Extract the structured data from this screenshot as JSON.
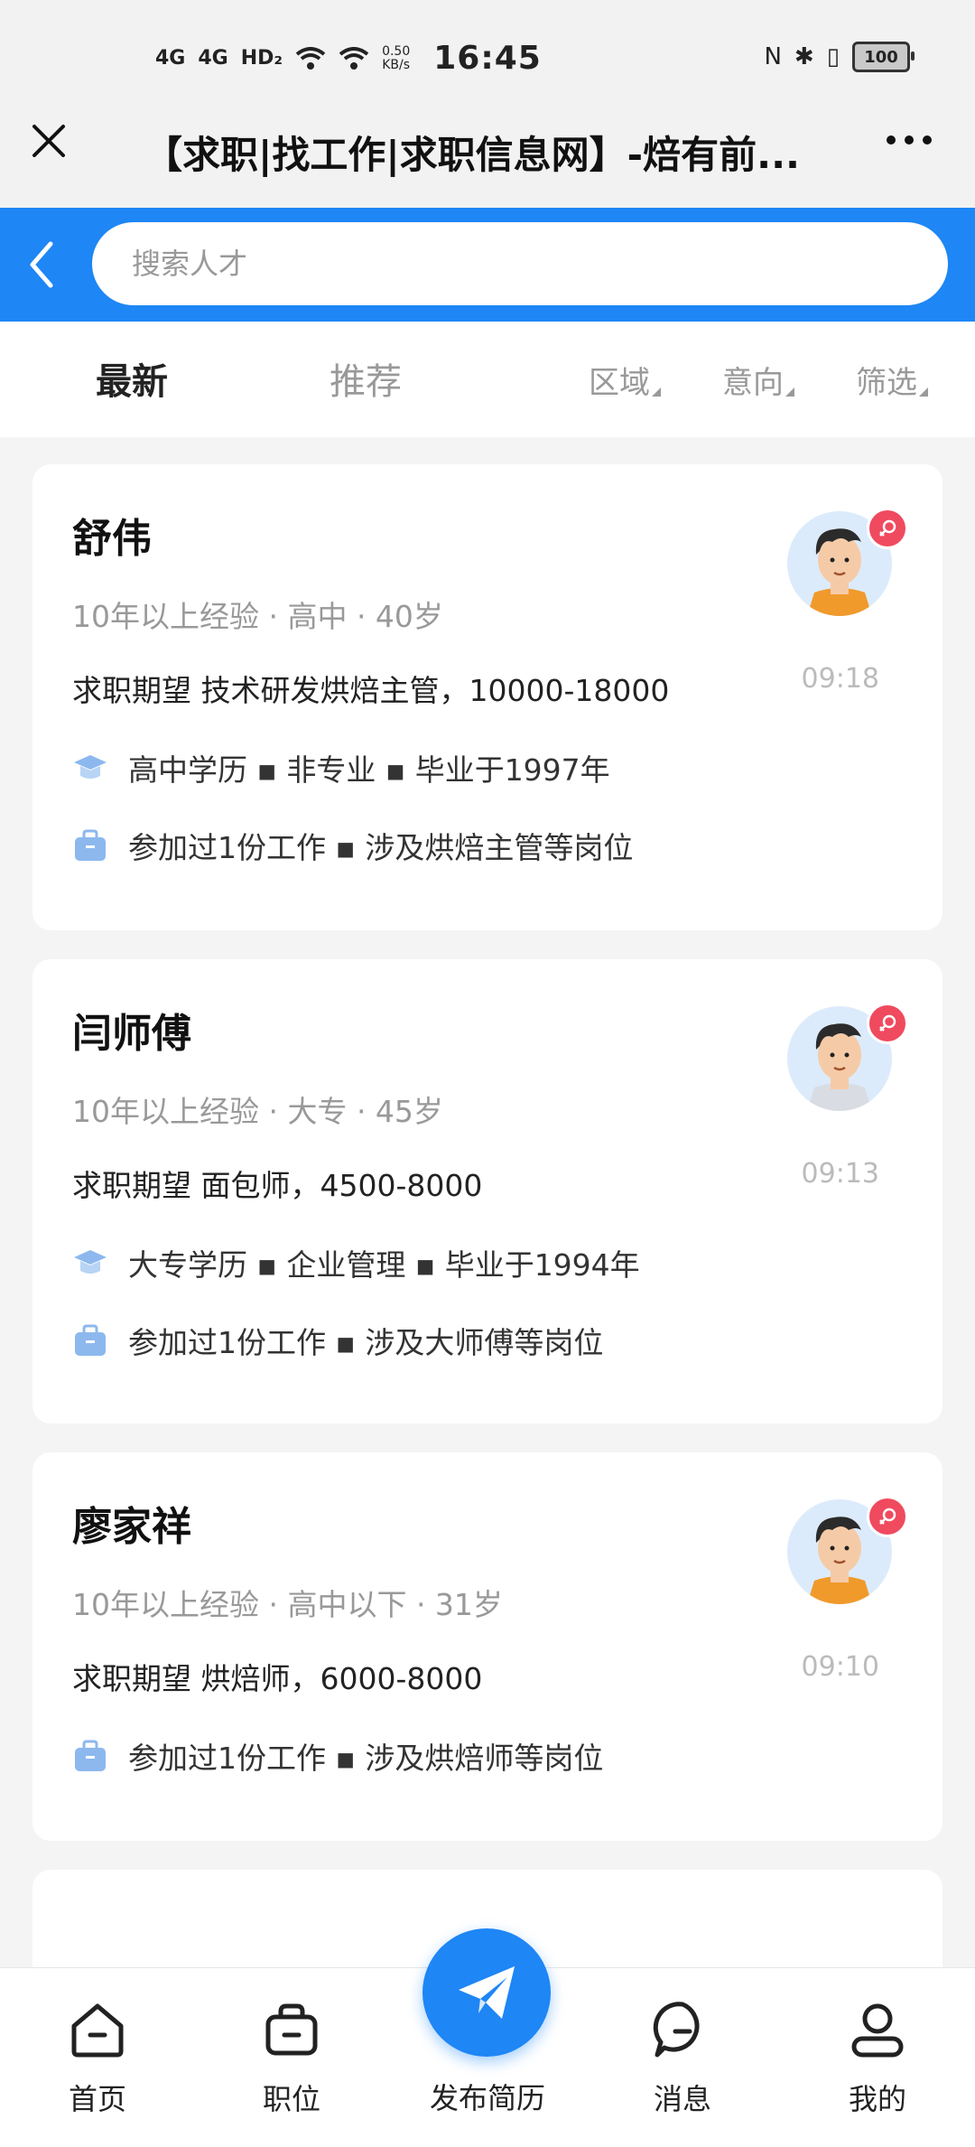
{
  "status_bar": {
    "network1": "4G",
    "network2": "4G",
    "hd": "HD₂",
    "speed_value": "0.50",
    "speed_unit": "KB/s",
    "time": "16:45",
    "battery": "100"
  },
  "header": {
    "title": "【求职|找工作|求职信息网】-焙有前..."
  },
  "search": {
    "placeholder": "搜索人才"
  },
  "tabs": {
    "latest": "最新",
    "recommend": "推荐"
  },
  "filters": {
    "area": "区域",
    "intent": "意向",
    "filter": "筛选"
  },
  "candidates": [
    {
      "name": "舒伟",
      "meta": "10年以上经验 · 高中 · 40岁",
      "expectation": "求职期望 技术研发烘焙主管，10000-18000",
      "education": "高中学历  ▪  非专业  ▪  毕业于1997年",
      "work": "参加过1份工作  ▪  涉及烘焙主管等岗位",
      "time": "09:18"
    },
    {
      "name": "闫师傅",
      "meta": "10年以上经验 · 大专 · 45岁",
      "expectation": "求职期望 面包师，4500-8000",
      "education": "大专学历  ▪  企业管理  ▪  毕业于1994年",
      "work": "参加过1份工作  ▪  涉及大师傅等岗位",
      "time": "09:13"
    },
    {
      "name": "廖家祥",
      "meta": "10年以上经验 · 高中以下 · 31岁",
      "expectation": "求职期望 烘焙师，6000-8000",
      "work": "参加过1份工作  ▪  涉及烘焙师等岗位",
      "time": "09:10"
    }
  ],
  "tabbar": {
    "home": "首页",
    "jobs": "职位",
    "publish": "发布简历",
    "messages": "消息",
    "me": "我的"
  },
  "colors": {
    "accent": "#1e86f5",
    "badge": "#f04a5f",
    "background": "#f4f4f5"
  },
  "icons": [
    "close-icon",
    "more-icon",
    "back-icon",
    "graduation-cap-icon",
    "briefcase-icon",
    "home-icon",
    "jobs-icon",
    "send-icon",
    "message-icon",
    "profile-icon"
  ]
}
